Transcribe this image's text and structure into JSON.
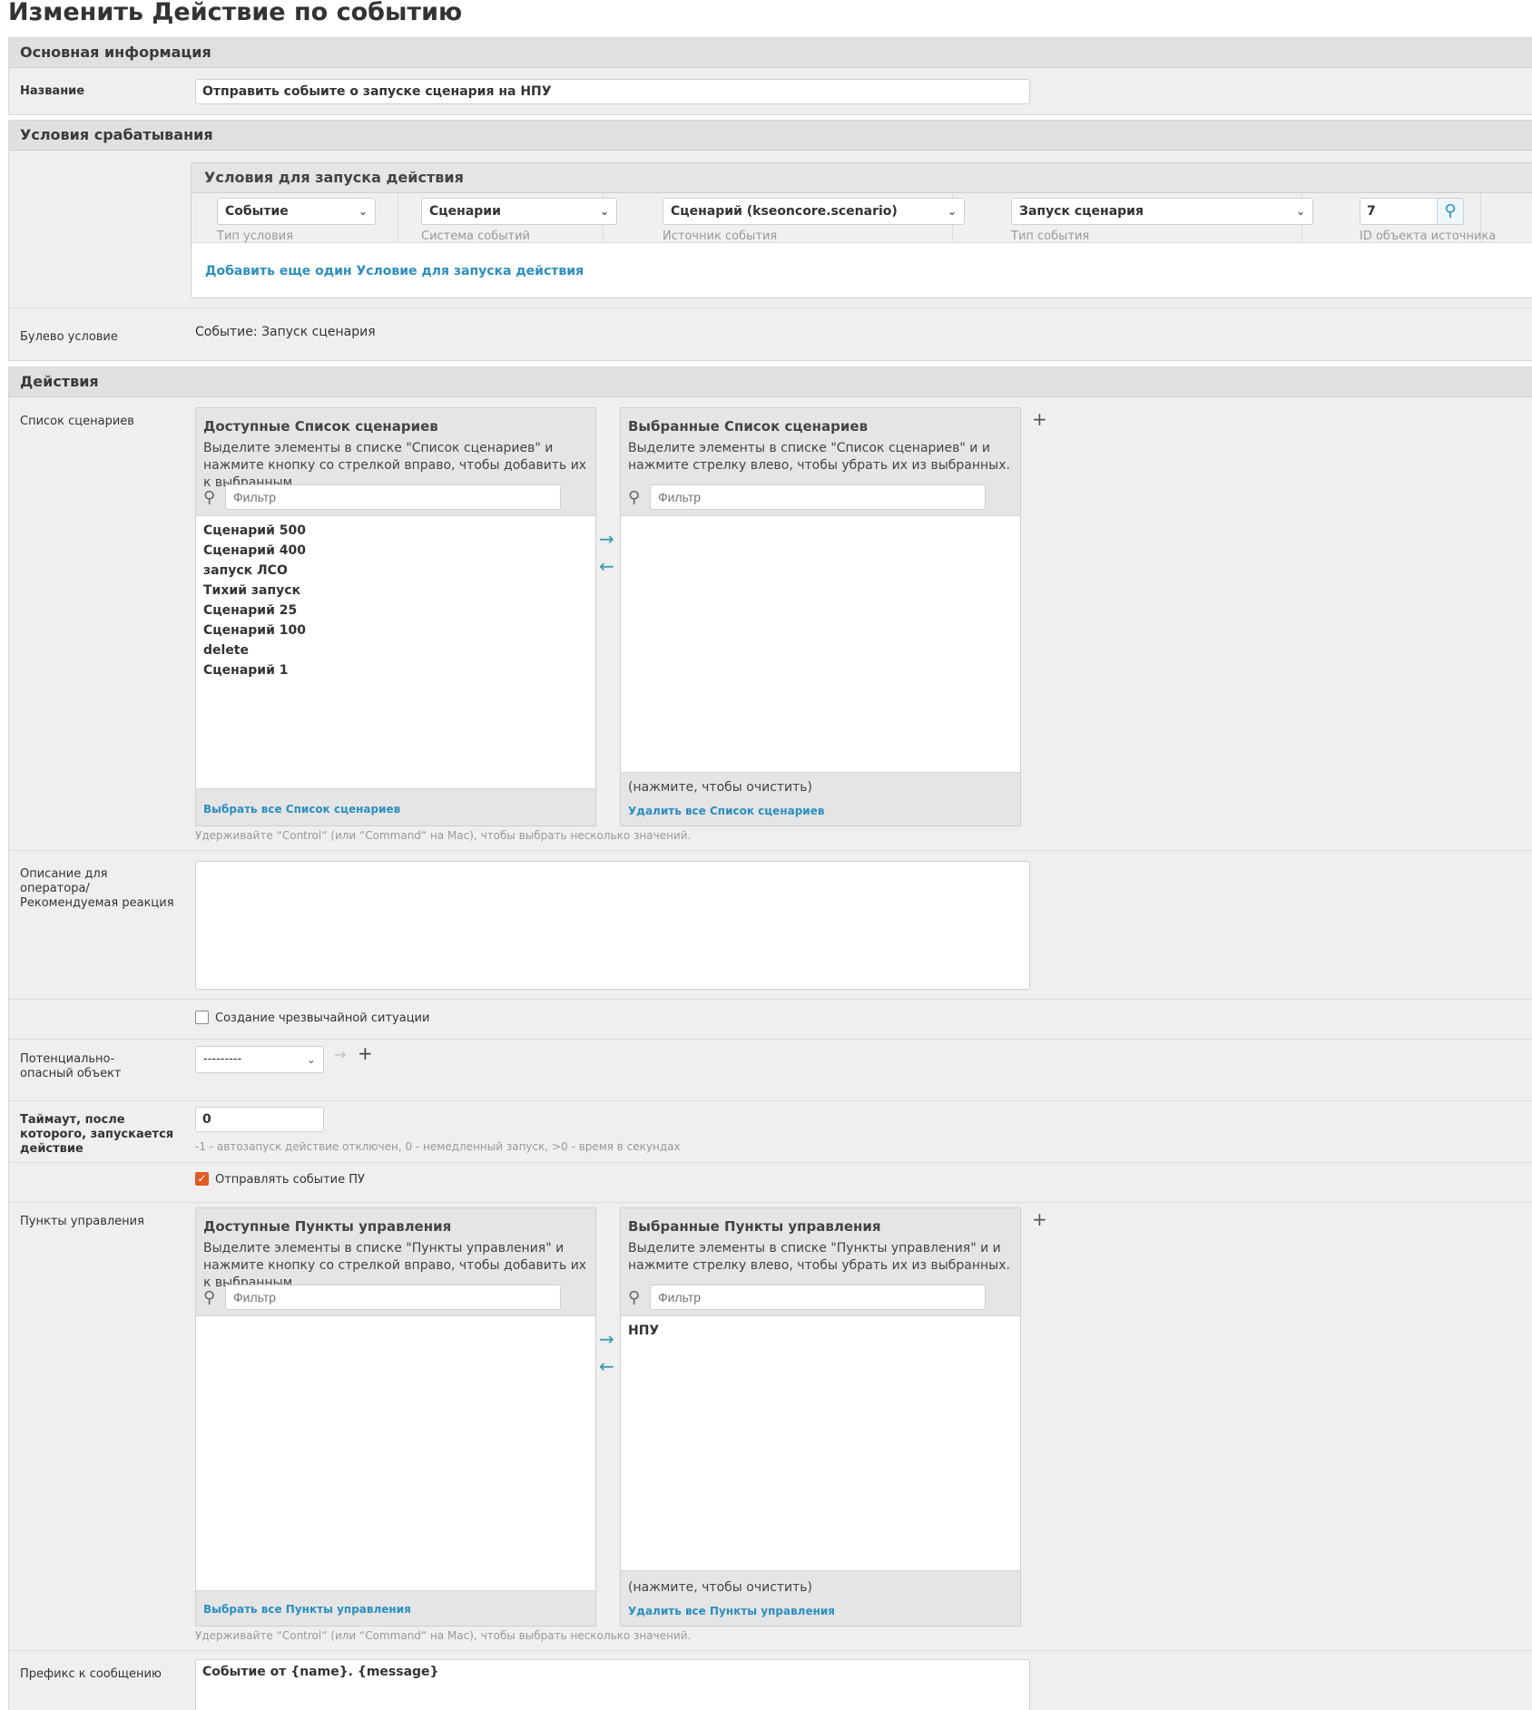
{
  "page": {
    "title": "Изменить Действие по событию"
  },
  "basic": {
    "header": "Основная информация",
    "name_label": "Название",
    "name_value": "Отправить собыите о запуске сценария на НПУ"
  },
  "conditions": {
    "header": "Условия срабатывания",
    "group_header": "Условия для запуска действия",
    "fields": [
      {
        "value": "Событие",
        "help": "Тип условия"
      },
      {
        "value": "Сценарии",
        "help": "Система событий"
      },
      {
        "value": "Сценарий (kseoncore.scenario)",
        "help": "Источник события"
      },
      {
        "value": "Запуск сценария",
        "help": "Тип события"
      },
      {
        "value": "7",
        "help": "ID объекта источника"
      }
    ],
    "add_link": "Добавить еще один Условие для запуска действия",
    "bool_label": "Булево условие",
    "bool_value": "Событие: Запуск сценария"
  },
  "actions": {
    "header": "Действия",
    "scenarios": {
      "label": "Список сценариев",
      "available_title": "Доступные Список сценариев",
      "available_desc": "Выделите элементы в списке \"Список сценариев\" и нажмите кнопку со стрелкой вправо, чтобы добавить их к выбранным.",
      "filter_placeholder": "Фильтр",
      "available_items": [
        "Сценарий 500",
        "Сценарий 400",
        "запуск ЛСО",
        "Тихий запуск",
        "Сценарий 25",
        "Сценарий 100",
        "delete",
        "Сценарий 1"
      ],
      "choose_all": "Выбрать все Список сценариев",
      "chosen_title": "Выбранные Список сценариев",
      "chosen_desc": "Выделите элементы в списке \"Список сценариев\" и и нажмите стрелку влево, чтобы убрать их из выбранных.",
      "chosen_items": [],
      "clear_hint": "(нажмите, чтобы очистить)",
      "remove_all": "Удалить все Список сценариев",
      "help": "Удерживайте “Control“ (или “Command“ на Mac), чтобы выбрать несколько значений."
    },
    "description_label": "Описание для оператора/ Рекомендуемая реакция",
    "emergency": {
      "label": "Создание чрезвычайной ситуации",
      "checked": false
    },
    "hazard": {
      "label": "Потенциально-опасный объект",
      "value": "---------"
    },
    "timeout": {
      "label": "Таймаут, после которого, запускается действие",
      "value": "0",
      "help": "-1 - автозапуск действие отключен, 0 - немедленный запуск, >0 - время в секундах"
    },
    "send_event": {
      "label": "Отправлять событие ПУ",
      "checked": true
    },
    "control_points": {
      "label": "Пункты управления",
      "available_title": "Доступные Пункты управления",
      "available_desc": "Выделите элементы в списке \"Пункты управления\" и нажмите кнопку со стрелкой вправо, чтобы добавить их к выбранным.",
      "filter_placeholder": "Фильтр",
      "available_items": [],
      "choose_all": "Выбрать все Пункты управления",
      "chosen_title": "Выбранные Пункты управления",
      "chosen_desc": "Выделите элементы в списке \"Пункты управления\" и и нажмите стрелку влево, чтобы убрать их из выбранных.",
      "chosen_items": [
        "НПУ"
      ],
      "clear_hint": "(нажмите, чтобы очистить)",
      "remove_all": "Удалить все Пункты управления",
      "help": "Удерживайте “Control“ (или “Command“ на Mac), чтобы выбрать несколько значений."
    },
    "prefix": {
      "label": "Префикс к сообщению",
      "value": "Событие от {name}. {message}"
    }
  },
  "colors": {
    "link": "#2c8fc0",
    "checkbox_on": "#e25b25",
    "header_bg": "#e0e0e0",
    "panel_bg": "#efefef"
  }
}
